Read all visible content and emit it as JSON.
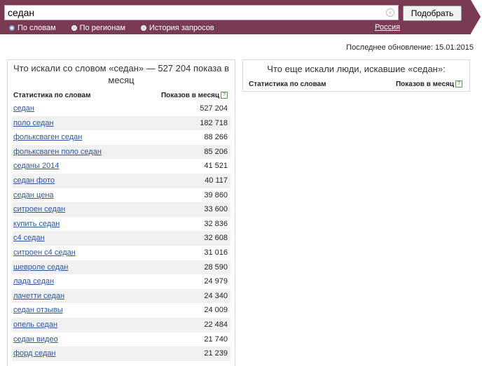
{
  "search": {
    "value": "седан",
    "submit_label": "Подобрать"
  },
  "modes": [
    {
      "label": "По словам",
      "selected": true
    },
    {
      "label": "По регионам",
      "selected": false
    },
    {
      "label": "История запросов",
      "selected": false
    }
  ],
  "region": "Россия",
  "last_update": "Последнее обновление: 15.01.2015",
  "left_panel": {
    "title": "Что искали со словом «седан» — 527 204 показа в месяц",
    "col_keyword": "Статистика по словам",
    "col_count": "Показов в месяц",
    "rows": [
      {
        "keyword": "седан",
        "count": "527 204"
      },
      {
        "keyword": "поло седан",
        "count": "182 718"
      },
      {
        "keyword": "фольксваген седан",
        "count": "88 266"
      },
      {
        "keyword": "фольксваген поло седан",
        "count": "85 206"
      },
      {
        "keyword": "седаны 2014",
        "count": "41 521"
      },
      {
        "keyword": "седан фото",
        "count": "40 117"
      },
      {
        "keyword": "седан цена",
        "count": "39 860"
      },
      {
        "keyword": "ситроен седан",
        "count": "33 600"
      },
      {
        "keyword": "купить седан",
        "count": "32 836"
      },
      {
        "keyword": "с4 седан",
        "count": "32 608"
      },
      {
        "keyword": "ситроен с4 седан",
        "count": "31 016"
      },
      {
        "keyword": "шевроле седан",
        "count": "28 590"
      },
      {
        "keyword": "лада седан",
        "count": "24 979"
      },
      {
        "keyword": "лачетти седан",
        "count": "24 340"
      },
      {
        "keyword": "седан отзывы",
        "count": "24 009"
      },
      {
        "keyword": "опель седан",
        "count": "22 484"
      },
      {
        "keyword": "седан видео",
        "count": "21 740"
      },
      {
        "keyword": "форд седан",
        "count": "21 239"
      }
    ]
  },
  "right_panel": {
    "title": "Что еще искали люди, искавшие «седан»:",
    "col_keyword": "Статистика по словам",
    "col_count": "Показов в месяц"
  },
  "icons": {
    "hint": "help-icon",
    "clear": "clear-icon"
  },
  "colors": {
    "topbar": "#7a3a54",
    "link": "#2b55a6",
    "row_alt": "#f1f1f1"
  }
}
